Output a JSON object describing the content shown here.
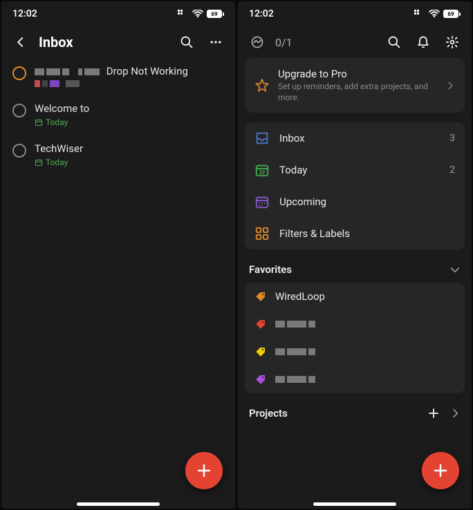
{
  "status": {
    "time": "12:02",
    "battery": "69"
  },
  "left": {
    "title": "Inbox",
    "tasks": [
      {
        "title_suffix": "Drop Not Working",
        "active": true,
        "metaType": "pixels"
      },
      {
        "title": "Welcome to",
        "metaType": "today"
      },
      {
        "title": "TechWiser",
        "metaType": "today"
      }
    ],
    "todayLabel": "Today"
  },
  "right": {
    "progress": "0/1",
    "promo": {
      "title": "Upgrade to Pro",
      "subtitle": "Set up reminders, add extra projects, and more."
    },
    "menu": [
      {
        "icon": "inbox",
        "label": "Inbox",
        "count": "3",
        "color": "#4a74c9"
      },
      {
        "icon": "today",
        "label": "Today",
        "count": "2",
        "color": "#3fb24f"
      },
      {
        "icon": "upcoming",
        "label": "Upcoming",
        "count": "",
        "color": "#8a5cd6"
      },
      {
        "icon": "filters",
        "label": "Filters & Labels",
        "count": "",
        "color": "#e38a29"
      }
    ],
    "favoritesTitle": "Favorites",
    "favorites": [
      {
        "color": "#e38a29",
        "label": "WiredLoop",
        "blurred": false
      },
      {
        "color": "#e44332",
        "blurred": true
      },
      {
        "color": "#f3cc00",
        "blurred": true
      },
      {
        "color": "#b050e0",
        "blurred": true
      }
    ],
    "projectsTitle": "Projects"
  }
}
